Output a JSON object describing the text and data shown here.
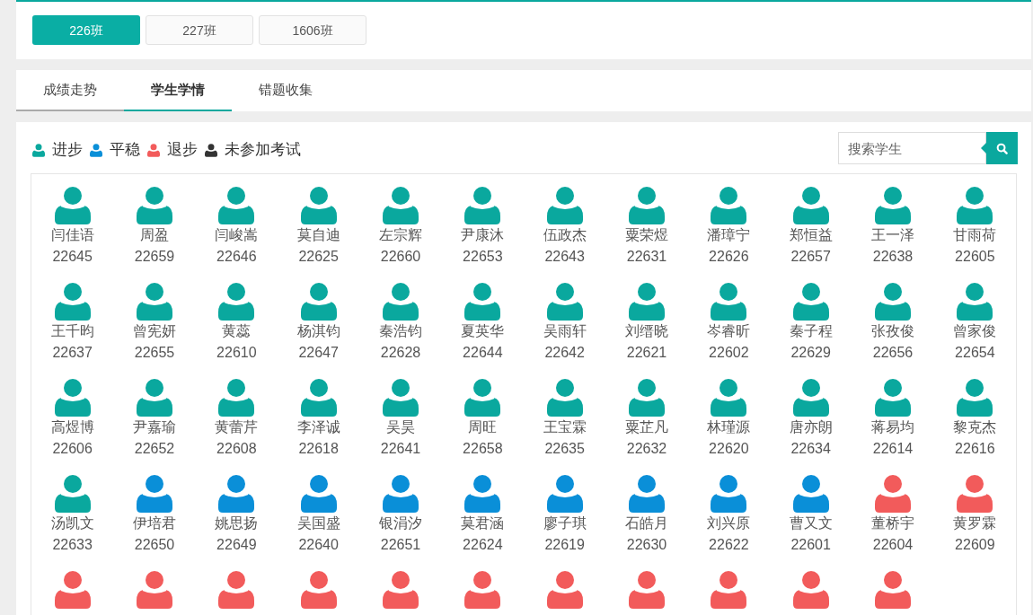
{
  "classes": [
    {
      "label": "226班",
      "selected": true
    },
    {
      "label": "227班",
      "selected": false
    },
    {
      "label": "1606班",
      "selected": false
    }
  ],
  "tabs": [
    {
      "label": "成绩走势",
      "selected": false,
      "hovered": true
    },
    {
      "label": "学生学情",
      "selected": true,
      "hovered": false
    },
    {
      "label": "错题收集",
      "selected": false,
      "hovered": false
    }
  ],
  "legend": [
    {
      "label": "进步",
      "color": "#0aa89e"
    },
    {
      "label": "平稳",
      "color": "#0a8fd8"
    },
    {
      "label": "退步",
      "color": "#f25b5b"
    },
    {
      "label": "未参加考试",
      "color": "#333333"
    }
  ],
  "search": {
    "placeholder": "搜索学生"
  },
  "students": [
    {
      "name": "闫佳语",
      "id": "22645",
      "color": "#0aa89e"
    },
    {
      "name": "周盈",
      "id": "22659",
      "color": "#0aa89e"
    },
    {
      "name": "闫峻嵩",
      "id": "22646",
      "color": "#0aa89e"
    },
    {
      "name": "莫自迪",
      "id": "22625",
      "color": "#0aa89e"
    },
    {
      "name": "左宗辉",
      "id": "22660",
      "color": "#0aa89e"
    },
    {
      "name": "尹康沐",
      "id": "22653",
      "color": "#0aa89e"
    },
    {
      "name": "伍政杰",
      "id": "22643",
      "color": "#0aa89e"
    },
    {
      "name": "粟荣煜",
      "id": "22631",
      "color": "#0aa89e"
    },
    {
      "name": "潘璋宁",
      "id": "22626",
      "color": "#0aa89e"
    },
    {
      "name": "郑恒益",
      "id": "22657",
      "color": "#0aa89e"
    },
    {
      "name": "王一泽",
      "id": "22638",
      "color": "#0aa89e"
    },
    {
      "name": "甘雨荷",
      "id": "22605",
      "color": "#0aa89e"
    },
    {
      "name": "王千昀",
      "id": "22637",
      "color": "#0aa89e"
    },
    {
      "name": "曾宪妍",
      "id": "22655",
      "color": "#0aa89e"
    },
    {
      "name": "黄蕊",
      "id": "22610",
      "color": "#0aa89e"
    },
    {
      "name": "杨淇钧",
      "id": "22647",
      "color": "#0aa89e"
    },
    {
      "name": "秦浩钧",
      "id": "22628",
      "color": "#0aa89e"
    },
    {
      "name": "夏英华",
      "id": "22644",
      "color": "#0aa89e"
    },
    {
      "name": "吴雨轩",
      "id": "22642",
      "color": "#0aa89e"
    },
    {
      "name": "刘缙晓",
      "id": "22621",
      "color": "#0aa89e"
    },
    {
      "name": "岑睿昕",
      "id": "22602",
      "color": "#0aa89e"
    },
    {
      "name": "秦子程",
      "id": "22629",
      "color": "#0aa89e"
    },
    {
      "name": "张孜俊",
      "id": "22656",
      "color": "#0aa89e"
    },
    {
      "name": "曾家俊",
      "id": "22654",
      "color": "#0aa89e"
    },
    {
      "name": "高煜博",
      "id": "22606",
      "color": "#0aa89e"
    },
    {
      "name": "尹嘉瑜",
      "id": "22652",
      "color": "#0aa89e"
    },
    {
      "name": "黄蕾芹",
      "id": "22608",
      "color": "#0aa89e"
    },
    {
      "name": "李泽诚",
      "id": "22618",
      "color": "#0aa89e"
    },
    {
      "name": "吴昊",
      "id": "22641",
      "color": "#0aa89e"
    },
    {
      "name": "周旺",
      "id": "22658",
      "color": "#0aa89e"
    },
    {
      "name": "王宝霖",
      "id": "22635",
      "color": "#0aa89e"
    },
    {
      "name": "粟芷凡",
      "id": "22632",
      "color": "#0aa89e"
    },
    {
      "name": "林瑾源",
      "id": "22620",
      "color": "#0aa89e"
    },
    {
      "name": "唐亦朗",
      "id": "22634",
      "color": "#0aa89e"
    },
    {
      "name": "蒋易均",
      "id": "22614",
      "color": "#0aa89e"
    },
    {
      "name": "黎克杰",
      "id": "22616",
      "color": "#0aa89e"
    },
    {
      "name": "汤凯文",
      "id": "22633",
      "color": "#0aa89e"
    },
    {
      "name": "伊培君",
      "id": "22650",
      "color": "#0a8fd8"
    },
    {
      "name": "姚思扬",
      "id": "22649",
      "color": "#0a8fd8"
    },
    {
      "name": "吴国盛",
      "id": "22640",
      "color": "#0a8fd8"
    },
    {
      "name": "银涓汐",
      "id": "22651",
      "color": "#0a8fd8"
    },
    {
      "name": "莫君涵",
      "id": "22624",
      "color": "#0a8fd8"
    },
    {
      "name": "廖子琪",
      "id": "22619",
      "color": "#0a8fd8"
    },
    {
      "name": "石皓月",
      "id": "22630",
      "color": "#0a8fd8"
    },
    {
      "name": "刘兴原",
      "id": "22622",
      "color": "#0a8fd8"
    },
    {
      "name": "曹又文",
      "id": "22601",
      "color": "#0a8fd8"
    },
    {
      "name": "董桥宇",
      "id": "22604",
      "color": "#f25b5b"
    },
    {
      "name": "黄罗霖",
      "id": "22609",
      "color": "#f25b5b"
    },
    {
      "color": "#f25b5b"
    },
    {
      "color": "#f25b5b"
    },
    {
      "color": "#f25b5b"
    },
    {
      "color": "#f25b5b"
    },
    {
      "color": "#f25b5b"
    },
    {
      "color": "#f25b5b"
    },
    {
      "color": "#f25b5b"
    },
    {
      "color": "#f25b5b"
    },
    {
      "color": "#f25b5b"
    },
    {
      "color": "#f25b5b"
    },
    {
      "color": "#f25b5b"
    }
  ]
}
